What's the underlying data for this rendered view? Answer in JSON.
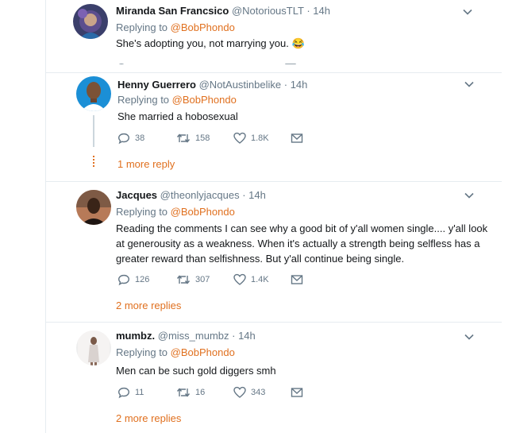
{
  "tweets": [
    {
      "name": "Miranda San Francsico",
      "handle": "@NotoriousTLT",
      "time": "· 14h",
      "replying_prefix": "Replying to ",
      "replying_to": "@BobPhondo",
      "body": "She's adopting you, not marrying you. 😂",
      "replies": "",
      "retweets": "",
      "likes": "",
      "more": ""
    },
    {
      "name": "Henny Guerrero",
      "handle": "@NotAustinbelike",
      "time": "· 14h",
      "replying_prefix": "Replying to ",
      "replying_to": "@BobPhondo",
      "body": "She married a hobosexual",
      "replies": "38",
      "retweets": "158",
      "likes": "1.8K",
      "more": "1 more reply"
    },
    {
      "name": "Jacques",
      "handle": "@theonlyjacques",
      "time": "· 14h",
      "replying_prefix": "Replying to ",
      "replying_to": "@BobPhondo",
      "body": "Reading the comments I can see why a good bit of y'all women single.... y'all look at generousity as a weakness. When it's actually a strength being selfless has a greater reward than selfishness. But y'all continue being single.",
      "replies": "126",
      "retweets": "307",
      "likes": "1.4K",
      "more": "2 more replies"
    },
    {
      "name": "mumbz.",
      "handle": "@miss_mumbz",
      "time": "· 14h",
      "replying_prefix": "Replying to ",
      "replying_to": "@BobPhondo",
      "body": "Men can be such gold diggers smh",
      "replies": "11",
      "retweets": "16",
      "likes": "343",
      "more": "2 more replies"
    }
  ],
  "colors": {
    "accent": "#e0701f",
    "muted": "#657786",
    "divider": "#e6ecf0"
  }
}
